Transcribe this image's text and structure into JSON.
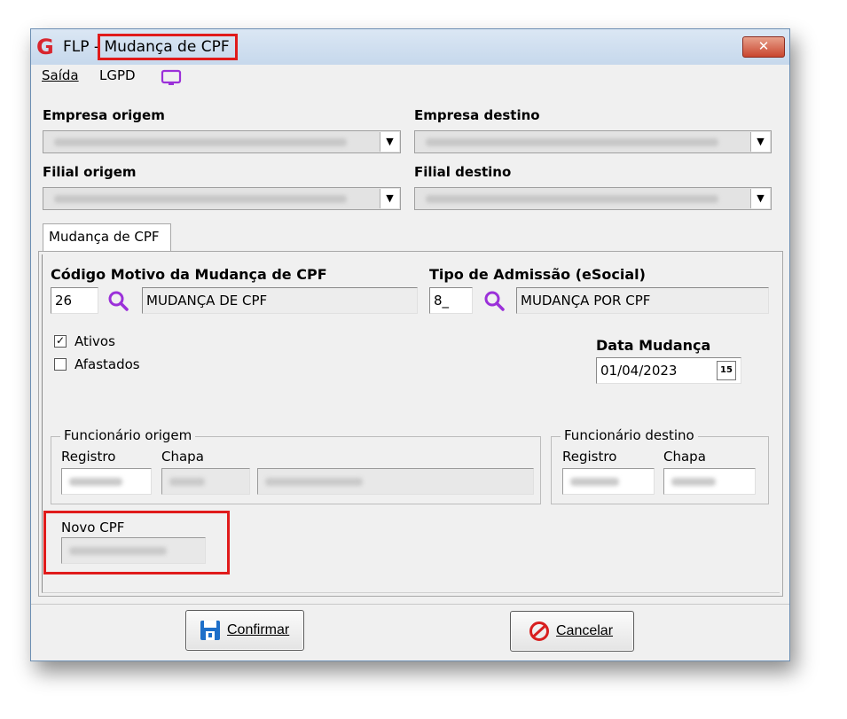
{
  "window": {
    "app_name": "FLP -",
    "title": "Mudança de CPF",
    "close_label": "✕"
  },
  "menu": {
    "exit_label": "Saída",
    "lgpd_label": "LGPD"
  },
  "company": {
    "origin_label": "Empresa origem",
    "dest_label": "Empresa destino",
    "branch_origin_label": "Filial origem",
    "branch_dest_label": "Filial destino"
  },
  "tab": {
    "label": "Mudança de CPF"
  },
  "form": {
    "reason_label": "Código Motivo da Mudança de CPF",
    "reason_code": "26",
    "reason_desc": "MUDANÇA DE CPF",
    "admission_label": "Tipo de Admissão (eSocial)",
    "admission_code": "8_",
    "admission_desc": "MUDANÇA POR CPF",
    "active_label": "Ativos",
    "active_checked": true,
    "away_label": "Afastados",
    "away_checked": false,
    "date_label": "Data Mudança",
    "date_value": "01/04/2023",
    "calendar_label": "15"
  },
  "employee_origin": {
    "legend": "Funcionário origem",
    "register_label": "Registro",
    "badge_label": "Chapa"
  },
  "employee_dest": {
    "legend": "Funcionário destino",
    "register_label": "Registro",
    "badge_label": "Chapa"
  },
  "new_cpf": {
    "label": "Novo CPF"
  },
  "buttons": {
    "confirm_label": "Confirmar",
    "cancel_label": "Cancelar"
  },
  "colors": {
    "highlight": "#e01b1b",
    "accent_purple": "#9b30d9",
    "logo_red": "#d8262f"
  },
  "icons": {
    "logo": "flp-logo-icon",
    "lgpd": "monitor-icon",
    "lookup": "search-icon",
    "calendar": "calendar-icon",
    "confirm": "floppy-disk-icon",
    "cancel": "cancel-icon"
  }
}
